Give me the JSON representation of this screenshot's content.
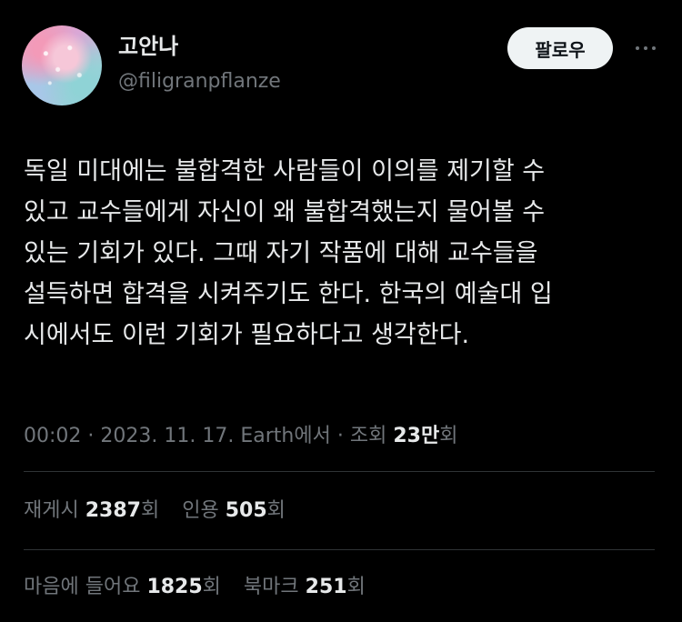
{
  "author": {
    "name": "고안나",
    "handle": "@filigranpflanze"
  },
  "actions": {
    "follow_label": "팔로우",
    "more_icon": "more-horizontal-icon"
  },
  "tweet": {
    "lines": [
      "독일 미대에는 불합격한 사람들이 이의를 제기할 수",
      "있고 교수들에게 자신이 왜 불합격했는지 물어볼 수",
      "있는 기회가 있다.  그때 자기 작품에 대해 교수들을",
      "설득하면 합격을 시켜주기도 한다. 한국의 예술대 입",
      "시에서도 이런 기회가 필요하다고 생각한다."
    ]
  },
  "meta": {
    "time": "00:02",
    "separator": "·",
    "date": "2023. 11. 17.",
    "source": "Earth에서",
    "views_label": "조회",
    "views_value": "23만",
    "views_suffix": "회"
  },
  "stats": {
    "reposts": {
      "label": "재게시",
      "value": "2387",
      "suffix": "회"
    },
    "quotes": {
      "label": "인용",
      "value": "505",
      "suffix": "회"
    },
    "likes": {
      "label": "마음에 들어요",
      "value": "1825",
      "suffix": "회"
    },
    "bookmarks": {
      "label": "북마크",
      "value": "251",
      "suffix": "회"
    }
  }
}
